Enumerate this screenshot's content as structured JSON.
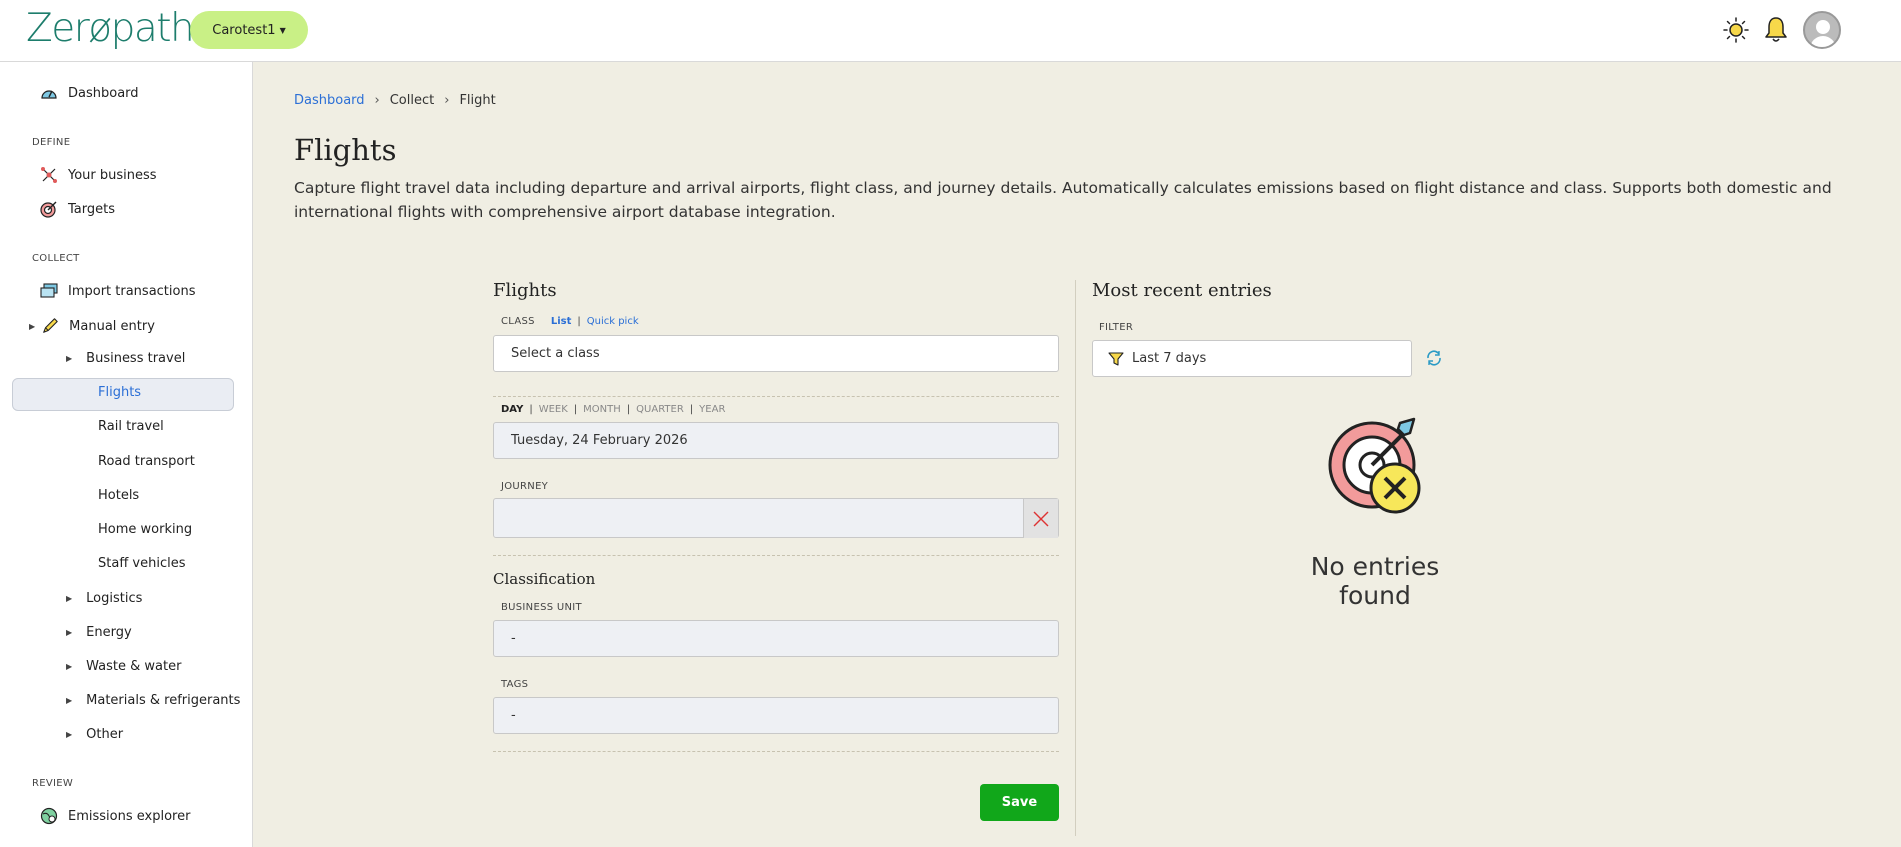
{
  "app": {
    "logo": "Zerøpath",
    "org_selector": "Carotest1"
  },
  "topbar": {
    "icons": [
      "sun-icon",
      "bell-icon",
      "user-avatar"
    ]
  },
  "sidebar": {
    "dashboard": "Dashboard",
    "section_define": "DEFINE",
    "your_business": "Your business",
    "targets": "Targets",
    "section_collect": "COLLECT",
    "import_transactions": "Import transactions",
    "manual_entry": "Manual entry",
    "business_travel": "Business travel",
    "flights": "Flights",
    "rail_travel": "Rail travel",
    "road_transport": "Road transport",
    "hotels": "Hotels",
    "home_working": "Home working",
    "staff_vehicles": "Staff vehicles",
    "logistics": "Logistics",
    "energy": "Energy",
    "waste_water": "Waste & water",
    "materials": "Materials & refrigerants",
    "other": "Other",
    "section_review": "REVIEW",
    "emissions_explorer": "Emissions explorer"
  },
  "breadcrumb": {
    "home": "Dashboard",
    "collect": "Collect",
    "current": "Flight"
  },
  "page": {
    "title": "Flights",
    "description": "Capture flight travel data including departure and arrival airports, flight class, and journey details. Automatically calculates emissions based on flight distance and class. Supports both domestic and international flights with comprehensive airport database integration."
  },
  "form": {
    "heading": "Flights",
    "class_label": "CLASS",
    "class_mode_list": "List",
    "class_mode_sep": "|",
    "class_mode_quick": "Quick pick",
    "class_placeholder": "Select a class",
    "period_day": "DAY",
    "period_week": "WEEK",
    "period_month": "MONTH",
    "period_quarter": "QUARTER",
    "period_year": "YEAR",
    "date_value": "Tuesday, 24 February 2026",
    "journey_label": "JOURNEY",
    "journey_value": "",
    "classification_heading": "Classification",
    "business_unit_label": "BUSINESS UNIT",
    "business_unit_value": "-",
    "tags_label": "TAGS",
    "tags_value": "-",
    "save_label": "Save"
  },
  "recent": {
    "heading": "Most recent entries",
    "filter_label": "FILTER",
    "filter_value": "Last 7 days",
    "empty_text": "No entries found"
  }
}
